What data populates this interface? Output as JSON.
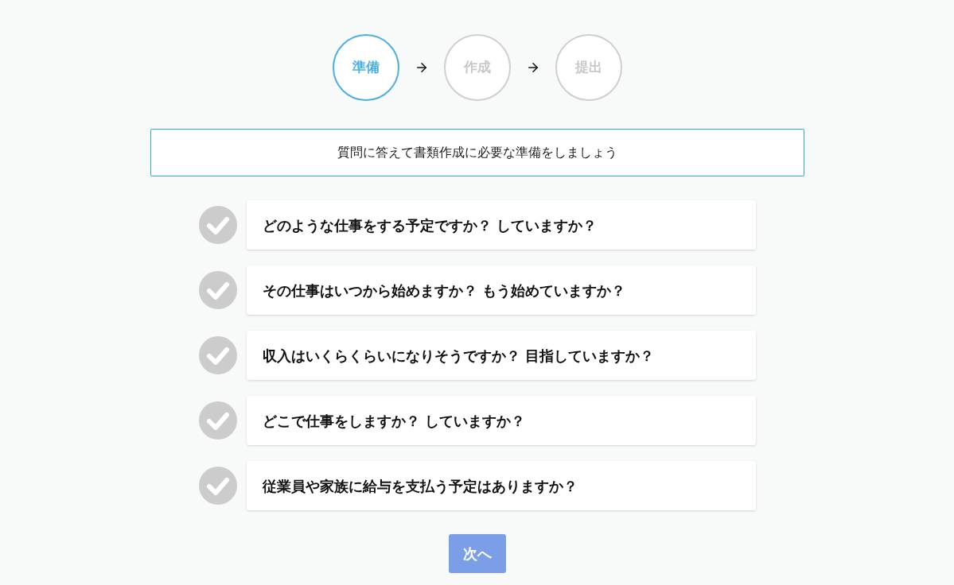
{
  "steps": [
    {
      "label": "準備",
      "selected": true
    },
    {
      "label": "作成",
      "selected": false
    },
    {
      "label": "提出",
      "selected": false
    }
  ],
  "instruction": "質問に答えて書類作成に必要な準備をしましょう",
  "questions": [
    {
      "text": "どのような仕事をする予定ですか？ していますか？",
      "checked": false
    },
    {
      "text": "その仕事はいつから始めますか？ もう始めていますか？",
      "checked": false
    },
    {
      "text": "収入はいくらくらいになりそうですか？ 目指していますか？",
      "checked": false
    },
    {
      "text": "どこで仕事をしますか？ していますか？",
      "checked": false
    },
    {
      "text": "従業員や家族に給与を支払う予定はありますか？",
      "checked": false
    }
  ],
  "next_button": {
    "label": "次へ",
    "disabled": true
  }
}
